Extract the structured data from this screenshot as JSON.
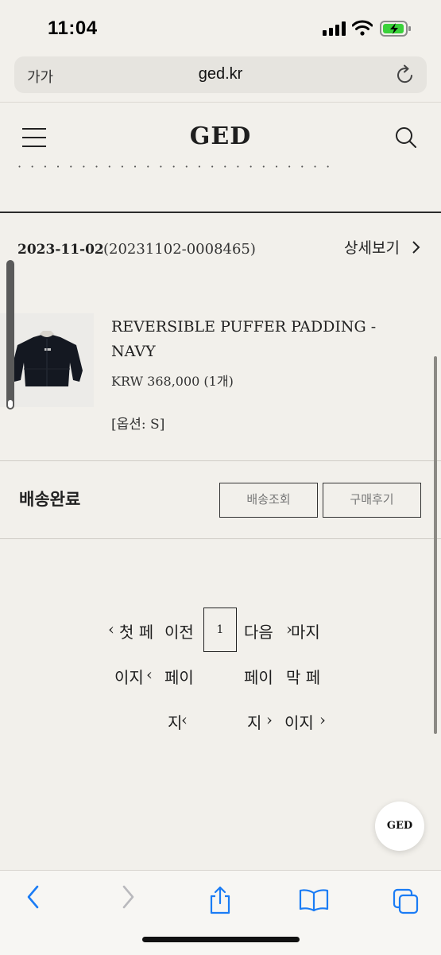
{
  "status_bar": {
    "time": "11:04",
    "battery_level": 0.8
  },
  "browser": {
    "text_size_label": "가가",
    "url": "ged.kr"
  },
  "header": {
    "logo": "GED"
  },
  "order": {
    "date": "2023-11-02",
    "number": "(20231102-0008465)",
    "detail_link": "상세보기",
    "product": {
      "name": "REVERSIBLE PUFFER PADDING - NAVY",
      "price": "KRW 368,000 (1개)",
      "option": "[옵션: S]"
    },
    "shipping_status": "배송완료",
    "track_button": "배송조회",
    "review_button": "구매후기"
  },
  "pagination": {
    "first_1": "첫 페",
    "first_2": "이지",
    "first_3": "지",
    "prev_1": "이전",
    "prev_2": "페이",
    "current": "1",
    "next_1": "다음",
    "next_2": "페이",
    "next_3": "지",
    "last_1": "마지",
    "last_2": "막 페",
    "last_3": "이지"
  },
  "floating_button": {
    "label": "GED"
  },
  "icons": {
    "back": "chevron-left-icon",
    "forward": "chevron-right-icon",
    "share": "share-icon",
    "bookmarks": "book-icon",
    "tabs": "tabs-icon",
    "reload": "reload-icon",
    "search": "search-icon",
    "menu": "hamburger-icon"
  },
  "colors": {
    "background": "#f2f0eb",
    "accent": "#007aff",
    "battery": "#3ad13a"
  }
}
